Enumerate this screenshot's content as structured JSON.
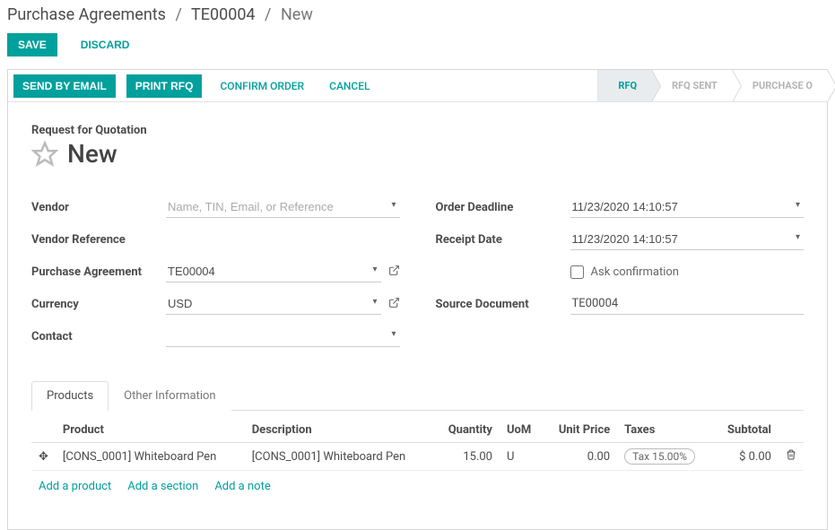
{
  "breadcrumb": {
    "root": "Purchase Agreements",
    "ref": "TE00004",
    "current": "New"
  },
  "actions": {
    "save": "SAVE",
    "discard": "DISCARD"
  },
  "statusbar": {
    "send_by_email": "SEND BY EMAIL",
    "print_rfq": "PRINT RFQ",
    "confirm_order": "CONFIRM ORDER",
    "cancel": "CANCEL",
    "stages": [
      "RFQ",
      "RFQ SENT",
      "PURCHASE O"
    ]
  },
  "header": {
    "subtitle": "Request for Quotation",
    "title": "New"
  },
  "fields": {
    "vendor_label": "Vendor",
    "vendor_placeholder": "Name, TIN, Email, or Reference",
    "vendor_ref_label": "Vendor Reference",
    "pa_label": "Purchase Agreement",
    "pa_value": "TE00004",
    "currency_label": "Currency",
    "currency_value": "USD",
    "contact_label": "Contact",
    "order_deadline_label": "Order Deadline",
    "order_deadline_value": "11/23/2020 14:10:57",
    "receipt_date_label": "Receipt Date",
    "receipt_date_value": "11/23/2020 14:10:57",
    "ask_confirmation": "Ask confirmation",
    "source_doc_label": "Source Document",
    "source_doc_value": "TE00004"
  },
  "tabs": {
    "products": "Products",
    "other": "Other Information"
  },
  "grid": {
    "headers": {
      "product": "Product",
      "description": "Description",
      "quantity": "Quantity",
      "uom": "UoM",
      "unit_price": "Unit Price",
      "taxes": "Taxes",
      "subtotal": "Subtotal"
    },
    "rows": [
      {
        "product": "[CONS_0001] Whiteboard Pen",
        "description": "[CONS_0001] Whiteboard Pen",
        "quantity": "15.00",
        "uom": "U",
        "unit_price": "0.00",
        "tax": "Tax 15.00%",
        "subtotal": "$ 0.00"
      }
    ],
    "add_product": "Add a product",
    "add_section": "Add a section",
    "add_note": "Add a note"
  }
}
